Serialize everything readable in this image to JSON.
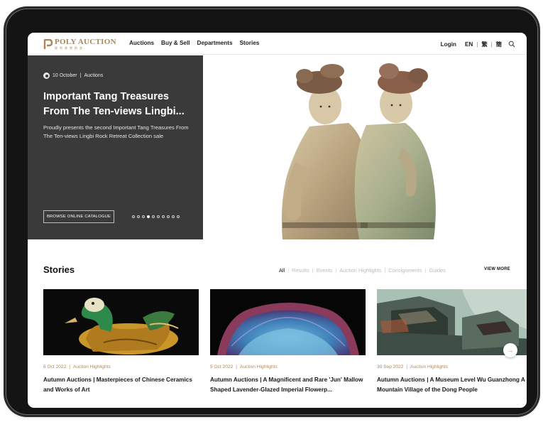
{
  "header": {
    "logo_text": "POLY AUCTION",
    "logo_sub": "保利香港拍卖",
    "nav": [
      "Auctions",
      "Buy & Sell",
      "Departments",
      "Stories"
    ],
    "login": "Login",
    "lang_en": "EN",
    "lang_trad": "繁",
    "lang_simp": "簡",
    "search_icon": "search-icon"
  },
  "hero": {
    "date": "10 October",
    "category": "Auctions",
    "title": "Important Tang Treasures From The Ten-views Lingbi...",
    "description": "Proudly presents the second Important Tang Treasures From The Ten-views Lingbi Rock Retreat Collection sale",
    "button": "BROWSE ONLINE CATALOGUE",
    "slide_count": 10,
    "active_slide": 4
  },
  "stories": {
    "title": "Stories",
    "filters": [
      "All",
      "Results",
      "Events",
      "Auction Highlights",
      "Consignments",
      "Guides"
    ],
    "active_filter": "All",
    "view_more": "VIEW MORE",
    "cards": [
      {
        "date": "6 Oct 2022",
        "category": "Auction Highlights",
        "title": "Autumn Auctions | Masterpieces of Chinese Ceramics and Works of Art"
      },
      {
        "date": "5 Oct 2022",
        "category": "Auction Highlights",
        "title": "Autumn Auctions | A Magnificent and Rare 'Jun' Mallow Shaped Lavender-Glazed Imperial Flowerp..."
      },
      {
        "date": "30 Sep 2022",
        "category": "Auction Highlights",
        "title": "Autumn Auctions | A Museum Level Wu Guanzhong A Mountain Village of the Dong People"
      }
    ]
  },
  "colors": {
    "accent": "#b8874a",
    "hero_panel": "#3a3a3a",
    "frame": "#141414"
  }
}
